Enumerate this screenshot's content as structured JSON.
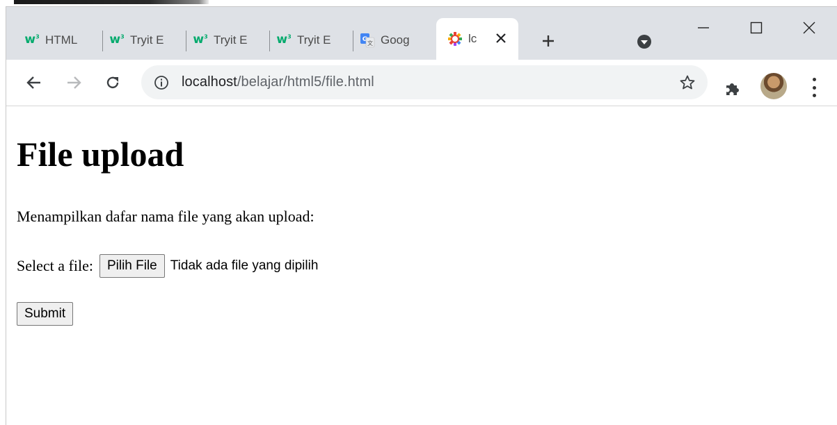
{
  "browser": {
    "tabs": [
      {
        "label": "HTML",
        "favicon": "w3schools-icon"
      },
      {
        "label": "Tryit E",
        "favicon": "w3schools-icon"
      },
      {
        "label": "Tryit E",
        "favicon": "w3schools-icon"
      },
      {
        "label": "Tryit E",
        "favicon": "w3schools-icon"
      },
      {
        "label": "Goog",
        "favicon": "google-translate-icon"
      },
      {
        "label": "lc",
        "favicon": "colorful-gear-icon",
        "active": true
      }
    ],
    "url_host": "localhost",
    "url_path": "/belajar/html5/file.html",
    "colors": {
      "titlebar": "#dee1e6",
      "omnibox": "#f1f3f4",
      "w3_green": "#04aa6d"
    }
  },
  "page": {
    "title": "File upload",
    "intro": "Menampilkan dafar nama file yang akan upload:",
    "file_label": "Select a file:",
    "file_button": "Pilih File",
    "file_status": "Tidak ada file yang dipilih",
    "submit_label": "Submit"
  }
}
